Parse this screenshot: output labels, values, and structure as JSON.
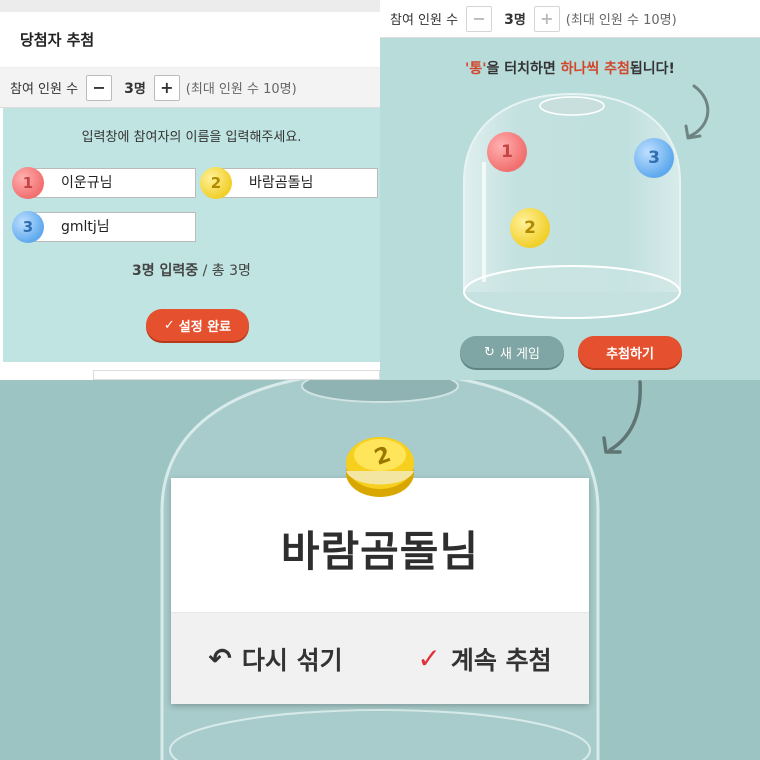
{
  "settings_panel": {
    "title": "당첨자 추첨",
    "count_label": "참여 인원 수",
    "count_value": "3",
    "count_unit": "명",
    "max_note": "(최대 인원 수 10명)",
    "minus_symbol": "−",
    "plus_symbol": "+",
    "instruction": "입력창에 참여자의 이름을 입력해주세요.",
    "participants": [
      {
        "num": "1",
        "name": "이운규님",
        "color": "red"
      },
      {
        "num": "2",
        "name": "바람곰돌님",
        "color": "yellow"
      },
      {
        "num": "3",
        "name": "gmltj님",
        "color": "blue"
      }
    ],
    "status_strong": "3명 입력중",
    "status_rest": " / 총 3명",
    "done_button": "설정 완료"
  },
  "draw_panel": {
    "count_label": "참여 인원 수",
    "count_value": "3",
    "count_unit": "명",
    "max_note": "(최대 인원 수 10명)",
    "minus_symbol": "−",
    "plus_symbol": "+",
    "instruction_quote": "'통'",
    "instruction_a": "을 터치하면 ",
    "instruction_hl": "하나씩 추첨",
    "instruction_b": "됩니다!",
    "balls": [
      "1",
      "3",
      "2"
    ],
    "new_game_button": "새 게임",
    "draw_button": "추첨하기"
  },
  "result_panel": {
    "coin_number": "2",
    "winner_name": "바람곰돌님",
    "reshuffle_button": "다시 섞기",
    "continue_button": "계속 추첨"
  },
  "colors": {
    "accent_red": "#e5502e",
    "teal_bg": "#bfe4e1",
    "ball_red": "#f26f6f",
    "ball_yellow": "#f2cf2a",
    "ball_blue": "#5fa9ee"
  },
  "icons": [
    "check-icon",
    "refresh-icon",
    "curved-arrow-icon",
    "undo-arrow-icon",
    "checkmark-icon"
  ]
}
